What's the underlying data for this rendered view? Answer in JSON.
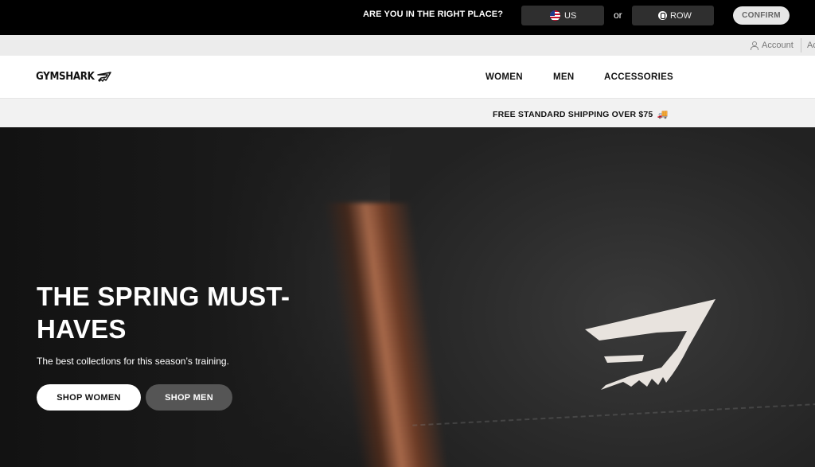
{
  "region_bar": {
    "question": "ARE YOU IN THE RIGHT PLACE?",
    "us_label": "US",
    "or_label": "or",
    "row_label": "ROW",
    "confirm_label": "CONFIRM"
  },
  "utility_bar": {
    "account_label": "Account",
    "cut_label": "Ac"
  },
  "header": {
    "logo_text": "GYMSHARK",
    "nav": [
      "WOMEN",
      "MEN",
      "ACCESSORIES"
    ]
  },
  "promo": {
    "text": "FREE STANDARD SHIPPING OVER $75",
    "icon": "truck-icon"
  },
  "hero": {
    "heading": "THE SPRING MUST-HAVES",
    "subtext": "The best collections for this season’s training.",
    "buttons": {
      "women": "SHOP WOMEN",
      "men": "SHOP MEN"
    }
  },
  "colors": {
    "region_bar_bg": "#000000",
    "utility_bar_bg": "#ececec",
    "promo_bg": "#f2f2f2",
    "secondary_button_bg": "#555555"
  }
}
